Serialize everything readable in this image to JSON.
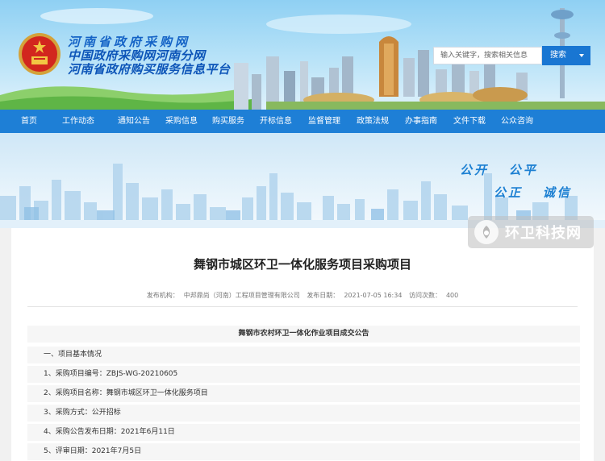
{
  "header": {
    "title_line1": "河南省政府采购网",
    "title_line2": "中国政府采购网河南分网",
    "title_line3": "河南省政府购买服务信息平台",
    "search_placeholder": "输入关键字，搜索相关信息",
    "search_button": "搜索"
  },
  "nav": {
    "items": [
      "首页",
      "工作动态",
      "通知公告",
      "采购信息",
      "购买服务",
      "开标信息",
      "监督管理",
      "政策法规",
      "办事指南",
      "文件下载",
      "公众咨询"
    ]
  },
  "banner": {
    "slogan_a1": "公开",
    "slogan_a2": "公平",
    "slogan_b1": "公正",
    "slogan_b2": "诚信"
  },
  "watermark": {
    "text": "环卫科技网"
  },
  "article": {
    "title": "舞钢市城区环卫一体化服务项目采购项目",
    "publisher_label": "发布机构：",
    "publisher": "中邦鼎尚（河南）工程项目管理有限公司",
    "date_label": "发布日期：",
    "date": "2021-07-05 16:34",
    "views_label": "访问次数：",
    "views": "400",
    "notice_title": "舞钢市农村环卫一体化作业项目成交公告",
    "lines": [
      "一、项目基本情况",
      "1、采购项目编号：ZBJS-WG-20210605",
      "2、采购项目名称：舞钢市城区环卫一体化服务项目",
      "3、采购方式：公开招标",
      "4、采购公告发布日期：2021年6月11日",
      "5、评审日期：2021年7月5日"
    ]
  },
  "colors": {
    "nav_bg": "#1e7fd6",
    "brand_blue": "#1976d2",
    "slogan": "#1b7fd2"
  }
}
